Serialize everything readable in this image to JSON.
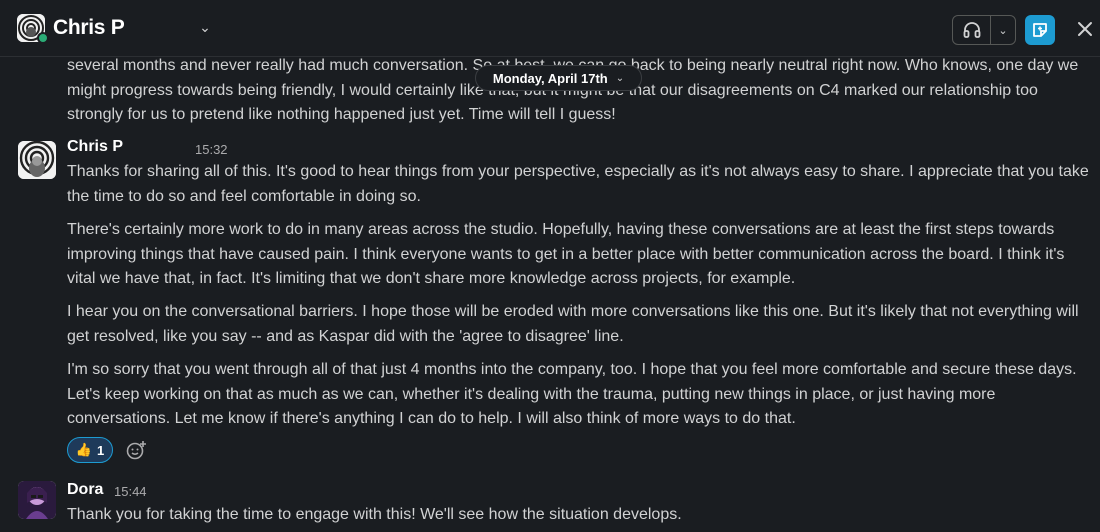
{
  "header": {
    "name": "Chris P",
    "name_icon": "chevron-down-icon",
    "huddle_icon": "headphones-icon",
    "huddle_caret_icon": "chevron-down-icon",
    "canvas_icon": "canvas-icon",
    "close_icon": "close-icon",
    "accent": "#1d9bd1",
    "presence_color": "#2bac76"
  },
  "date_divider": {
    "label": "Monday, April 17th",
    "chevron": "⌄"
  },
  "messages": [
    {
      "continued_text": [
        "several months and never really had much conversation. So at best, we can go back to being nearly neutral right now. Who knows, one day we might progress towards being friendly, I would certainly like that, but it might be that our disagreements on C4 marked our relationship too strongly for us to pretend like nothing happened just yet. Time will tell I guess!"
      ]
    },
    {
      "sender": "Chris P",
      "time": "15:32",
      "paragraphs": [
        "Thanks for sharing all of this. It's good to hear things from your perspective, especially as it's not always easy to share. I appreciate that you take the time to do so and feel comfortable in doing so.",
        "There's certainly more work to do in many areas across the studio. Hopefully, having these conversations are at least the first steps towards improving things that have caused pain. I think everyone wants to get in a better place with better communication across the board. I think it's vital we have that, in fact. It's limiting that we don't share more knowledge across projects, for example.",
        "I hear you on the conversational barriers. I hope those will be eroded with more conversations like this one. But it's likely that not everything will get resolved, like you say -- and as Kaspar did with the 'agree to disagree' line.",
        "I'm so sorry that you went through all of that just 4 months into the company, too. I hope that you feel more comfortable and secure these days. Let's keep working on that as much as we can, whether it's dealing with the trauma, putting new things in place, or just having more conversations. Let me know if there's anything I can do to help. I will also think of more ways to do that."
      ],
      "reaction": {
        "emoji": "👍",
        "count": "1"
      },
      "add_reaction_icon": "add-emoji-icon"
    },
    {
      "sender": "Dora",
      "time": "15:44",
      "paragraphs": [
        "Thank you for taking the time to engage with this! We'll see how the situation develops."
      ]
    }
  ]
}
